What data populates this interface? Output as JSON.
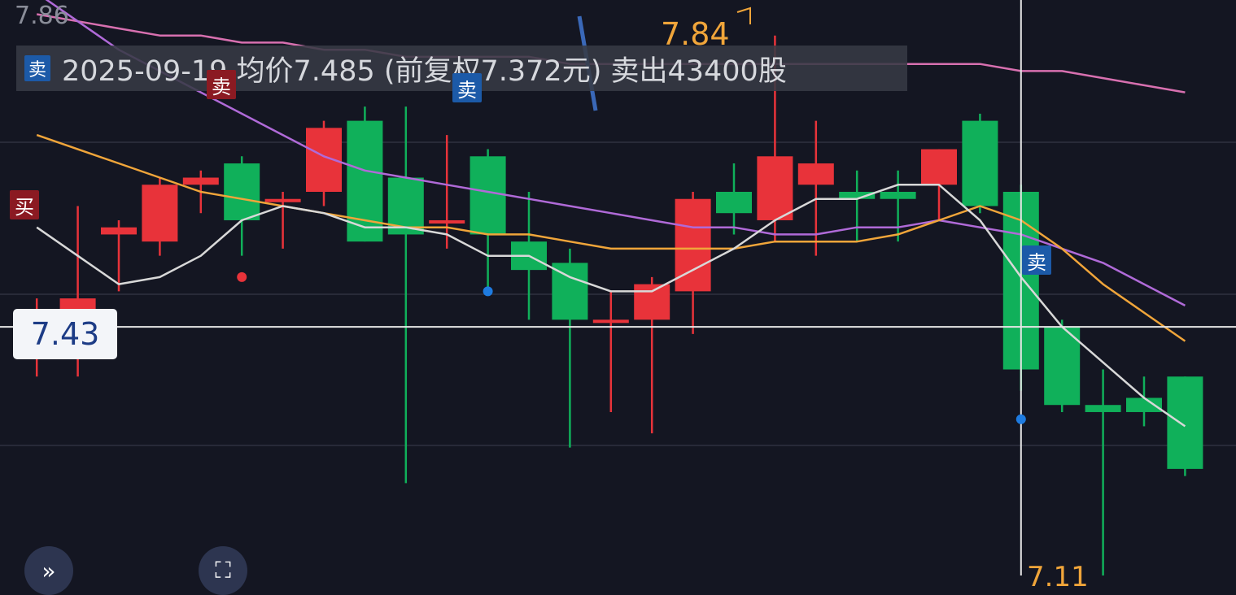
{
  "y_top_label": "7.86",
  "current_price_label": "7.43",
  "high_label": "7.84",
  "low_label": "7.11",
  "trade_banner": {
    "icon": "卖",
    "text": "2025-09-19 均价7.485 (前复权7.372元) 卖出43400股"
  },
  "markers": [
    {
      "kind": "sell",
      "text": "卖"
    },
    {
      "kind": "sell",
      "text": "卖"
    },
    {
      "kind": "buy",
      "text": "买"
    },
    {
      "kind": "buy",
      "text": "卖"
    }
  ],
  "buttons": {
    "expand": "»",
    "fullscreen": "⛶"
  },
  "colors": {
    "up": "#e8333a",
    "down": "#10b05a",
    "ma5": "#d8d8d8",
    "ma10": "#f0a53a",
    "ma20": "#b06ad8",
    "ma60": "#d870b0",
    "grid": "#2e3140",
    "crosshair": "#e6e6e6"
  },
  "chart_data": {
    "type": "candlestick",
    "ylim": [
      7.08,
      7.89
    ],
    "current_price": 7.43,
    "candles": [
      {
        "o": 7.39,
        "c": 7.45,
        "h": 7.47,
        "l": 7.36
      },
      {
        "o": 7.39,
        "c": 7.47,
        "h": 7.6,
        "l": 7.36
      },
      {
        "o": 7.56,
        "c": 7.57,
        "h": 7.58,
        "l": 7.48
      },
      {
        "o": 7.55,
        "c": 7.63,
        "h": 7.64,
        "l": 7.53
      },
      {
        "o": 7.63,
        "c": 7.64,
        "h": 7.65,
        "l": 7.59
      },
      {
        "o": 7.66,
        "c": 7.58,
        "h": 7.67,
        "l": 7.53
      },
      {
        "o": 7.61,
        "c": 7.61,
        "h": 7.62,
        "l": 7.54
      },
      {
        "o": 7.62,
        "c": 7.71,
        "h": 7.72,
        "l": 7.6
      },
      {
        "o": 7.72,
        "c": 7.55,
        "h": 7.74,
        "l": 7.55
      },
      {
        "o": 7.64,
        "c": 7.56,
        "h": 7.74,
        "l": 7.21
      },
      {
        "o": 7.58,
        "c": 7.58,
        "h": 7.7,
        "l": 7.54
      },
      {
        "o": 7.67,
        "c": 7.56,
        "h": 7.68,
        "l": 7.48
      },
      {
        "o": 7.55,
        "c": 7.51,
        "h": 7.62,
        "l": 7.44
      },
      {
        "o": 7.52,
        "c": 7.44,
        "h": 7.54,
        "l": 7.26
      },
      {
        "o": 7.44,
        "c": 7.44,
        "h": 7.48,
        "l": 7.31
      },
      {
        "o": 7.44,
        "c": 7.49,
        "h": 7.5,
        "l": 7.28
      },
      {
        "o": 7.48,
        "c": 7.61,
        "h": 7.62,
        "l": 7.42
      },
      {
        "o": 7.62,
        "c": 7.59,
        "h": 7.66,
        "l": 7.56
      },
      {
        "o": 7.58,
        "c": 7.67,
        "h": 7.84,
        "l": 7.55
      },
      {
        "o": 7.63,
        "c": 7.66,
        "h": 7.72,
        "l": 7.53
      },
      {
        "o": 7.62,
        "c": 7.61,
        "h": 7.65,
        "l": 7.55
      },
      {
        "o": 7.62,
        "c": 7.61,
        "h": 7.65,
        "l": 7.55
      },
      {
        "o": 7.63,
        "c": 7.68,
        "h": 7.68,
        "l": 7.58
      },
      {
        "o": 7.72,
        "c": 7.6,
        "h": 7.73,
        "l": 7.59
      },
      {
        "o": 7.62,
        "c": 7.37,
        "h": 7.63,
        "l": 7.34
      },
      {
        "o": 7.43,
        "c": 7.32,
        "h": 7.44,
        "l": 7.31
      },
      {
        "o": 7.32,
        "c": 7.31,
        "h": 7.37,
        "l": 7.08
      },
      {
        "o": 7.33,
        "c": 7.31,
        "h": 7.36,
        "l": 7.29
      },
      {
        "o": 7.36,
        "c": 7.23,
        "h": 7.36,
        "l": 7.22
      }
    ],
    "ma5": [
      7.57,
      7.53,
      7.49,
      7.5,
      7.53,
      7.58,
      7.6,
      7.59,
      7.57,
      7.57,
      7.56,
      7.53,
      7.53,
      7.5,
      7.48,
      7.48,
      7.51,
      7.54,
      7.58,
      7.61,
      7.61,
      7.63,
      7.63,
      7.58,
      7.5,
      7.43,
      7.38,
      7.33,
      7.29
    ],
    "ma10": [
      7.7,
      7.68,
      7.66,
      7.64,
      7.62,
      7.61,
      7.6,
      7.59,
      7.58,
      7.57,
      7.57,
      7.56,
      7.56,
      7.55,
      7.54,
      7.54,
      7.54,
      7.54,
      7.55,
      7.55,
      7.55,
      7.56,
      7.58,
      7.6,
      7.58,
      7.54,
      7.49,
      7.45,
      7.41
    ],
    "ma20": [
      7.9,
      7.86,
      7.82,
      7.79,
      7.76,
      7.73,
      7.7,
      7.67,
      7.65,
      7.64,
      7.63,
      7.62,
      7.61,
      7.6,
      7.59,
      7.58,
      7.57,
      7.57,
      7.56,
      7.56,
      7.57,
      7.57,
      7.58,
      7.57,
      7.56,
      7.54,
      7.52,
      7.49,
      7.46
    ],
    "ma60": [
      7.87,
      7.86,
      7.85,
      7.84,
      7.84,
      7.83,
      7.83,
      7.82,
      7.82,
      7.81,
      7.81,
      7.81,
      7.81,
      7.8,
      7.8,
      7.8,
      7.8,
      7.8,
      7.8,
      7.8,
      7.8,
      7.8,
      7.8,
      7.8,
      7.79,
      7.79,
      7.78,
      7.77,
      7.76
    ],
    "crosshair_index": 24.5
  }
}
